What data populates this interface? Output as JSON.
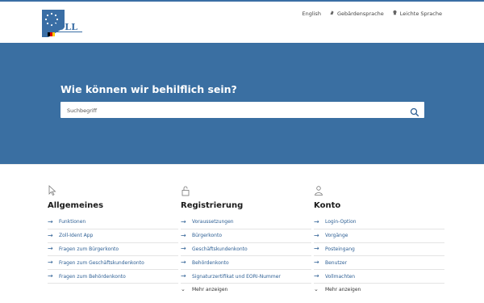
{
  "header": {
    "logo_text": "ZOLL",
    "links": [
      {
        "label": "English",
        "icon": ""
      },
      {
        "label": "Gebärdensprache",
        "icon": "sign-language-icon"
      },
      {
        "label": "Leichte Sprache",
        "icon": "easy-language-icon"
      }
    ]
  },
  "hero": {
    "title": "Wie können wir behilflich sein?",
    "search_placeholder": "Suchbegriff"
  },
  "columns": [
    {
      "icon": "cursor-icon",
      "title": "Allgemeines",
      "items": [
        "Funktionen",
        "Zoll-Ident App",
        "Fragen zum Bürgerkonto",
        "Fragen zum Geschäftskundenkonto",
        "Fragen zum Behördenkonto"
      ],
      "more": ""
    },
    {
      "icon": "lock-open-icon",
      "title": "Registrierung",
      "items": [
        "Voraussetzungen",
        "Bürgerkonto",
        "Geschäftskundenkonto",
        "Behördenkonto",
        "Signaturzertifikat und EORI-Nummer"
      ],
      "more": "Mehr anzeigen"
    },
    {
      "icon": "user-icon",
      "title": "Konto",
      "items": [
        "Login-Option",
        "Vorgänge",
        "Posteingang",
        "Benutzer",
        "Vollmachten"
      ],
      "more": "Mehr anzeigen"
    }
  ],
  "colors": {
    "brand": "#3a6fa2",
    "link": "#2d5f94"
  }
}
